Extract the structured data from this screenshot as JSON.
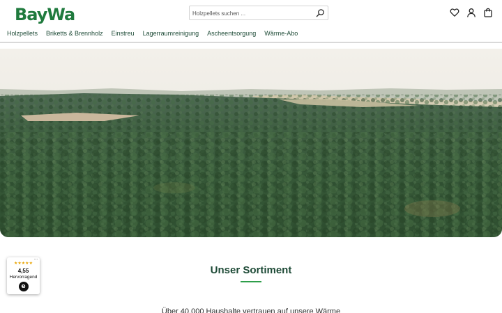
{
  "brand": {
    "logo_text": "BayWa",
    "color": "#1f7a3d"
  },
  "search": {
    "placeholder": "Holzpellets suchen ..."
  },
  "header_icons": [
    "heart-icon",
    "user-icon",
    "shopping-bag-icon"
  ],
  "nav": {
    "items": [
      {
        "label": "Holzpellets"
      },
      {
        "label": "Briketts & Brennholz"
      },
      {
        "label": "Einstreu"
      },
      {
        "label": "Lagerraumreinigung"
      },
      {
        "label": "Ascheentsorgung"
      },
      {
        "label": "Wärme-Abo"
      }
    ]
  },
  "rating_badge": {
    "stars": "★★★★★",
    "menu": "...",
    "score": "4,55",
    "verdict": "Hervorragend",
    "seal_letter": "e"
  },
  "section": {
    "title": "Unser Sortiment",
    "intro": "Über 40.000 Haushalte vertrauen auf unsere Wärme"
  },
  "colors": {
    "accent": "#2e9e4a",
    "nav_text": "#1d4a36",
    "star": "#e8a300"
  }
}
